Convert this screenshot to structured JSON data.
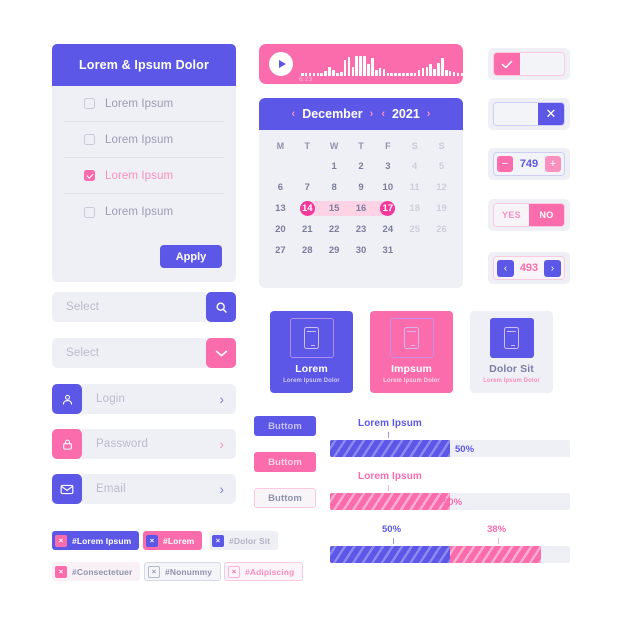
{
  "checkbox_card": {
    "title": "Lorem & Ipsum Dolor",
    "items": [
      {
        "label": "Lorem Ipsum",
        "checked": false
      },
      {
        "label": "Lorem Ipsum",
        "checked": false
      },
      {
        "label": "Lorem Ipsum",
        "checked": true
      },
      {
        "label": "Lorem Ipsum",
        "checked": false
      }
    ],
    "apply_label": "Apply"
  },
  "fields": {
    "select_search": {
      "placeholder": "Select",
      "icon": "search-icon"
    },
    "select_dropdown": {
      "placeholder": "Select",
      "icon": "chevron-down-icon"
    },
    "login": {
      "placeholder": "Login",
      "icon": "user-icon",
      "chevron": "›"
    },
    "password": {
      "placeholder": "Password",
      "icon": "lock-icon",
      "chevron": "›"
    },
    "email": {
      "placeholder": "Email",
      "icon": "envelope-icon",
      "chevron": "›"
    }
  },
  "tags": [
    {
      "label": "#Lorem Ipsum",
      "style": "blue-solid",
      "close": "×"
    },
    {
      "label": "#Lorem",
      "style": "pink-solid",
      "close": "×"
    },
    {
      "label": "#Dolor Sit",
      "style": "blue-light",
      "close": "×"
    },
    {
      "label": "#Consectetuer",
      "style": "pink-light",
      "close": "×"
    },
    {
      "label": "#Nonummy",
      "style": "grey-outline",
      "close": "×"
    },
    {
      "label": "#Adipiscing",
      "style": "pink-outline",
      "close": "×"
    }
  ],
  "player": {
    "time": "6:23",
    "play_icon": "play-icon",
    "waveform": [
      3,
      3,
      3,
      3,
      3,
      3,
      5,
      9,
      6,
      3,
      4,
      16,
      19,
      9,
      20,
      20,
      20,
      12,
      18,
      6,
      8,
      7,
      3,
      3,
      3,
      3,
      3,
      3,
      3,
      3,
      6,
      8,
      9,
      12,
      7,
      13,
      18,
      6,
      5,
      4,
      3,
      3
    ]
  },
  "calendar": {
    "month": "December",
    "year": "2021",
    "prev_icon": "chevron-left-icon",
    "next_icon": "chevron-right-icon",
    "dow": [
      "M",
      "T",
      "W",
      "T",
      "F",
      "S",
      "S"
    ],
    "blanks": 2,
    "days": [
      1,
      2,
      3,
      4,
      5,
      6,
      7,
      8,
      9,
      10,
      11,
      12,
      13,
      14,
      15,
      16,
      17,
      18,
      19,
      20,
      21,
      22,
      23,
      24,
      25,
      26,
      27,
      28,
      29,
      30,
      31
    ],
    "range_start": 14,
    "range_end": 17
  },
  "widgets": {
    "check": {
      "icon": "check-icon"
    },
    "close": {
      "icon": "close-icon",
      "glyph": "✕"
    },
    "number": {
      "value": "749",
      "minus": "−",
      "plus": "+"
    },
    "yesno": {
      "yes": "YES",
      "no": "NO"
    },
    "pager": {
      "value": "493",
      "prev": "‹",
      "next": "›"
    }
  },
  "cards": [
    {
      "title": "Lorem",
      "subtitle": "Lorem Ipsum Dolor",
      "icon": "tablet-icon"
    },
    {
      "title": "Impsum",
      "subtitle": "Lorem Ipsum Dolor",
      "icon": "tablet-icon"
    },
    {
      "title": "Dolor Sit",
      "subtitle": "Lorem Ipsum Dolor",
      "icon": "tablet-icon"
    }
  ],
  "buttons": [
    {
      "label": "Buttom",
      "style": "blue-solid"
    },
    {
      "label": "Buttom",
      "style": "pink-solid"
    },
    {
      "label": "Buttom",
      "style": "outline"
    }
  ],
  "progress": {
    "bar1": {
      "label": "Lorem Ipsum",
      "percent": "50%",
      "value": 50
    },
    "bar2": {
      "label": "Lorem Ipsum",
      "percent": "50%",
      "value": 50
    },
    "split": {
      "blue_percent": "50%",
      "blue_value": 50,
      "pink_percent": "38%",
      "pink_value": 38
    }
  },
  "colors": {
    "blue": "#5d57e8",
    "pink": "#fb6cad",
    "grey": "#eff0f5",
    "deep_pink": "#f4399c"
  }
}
